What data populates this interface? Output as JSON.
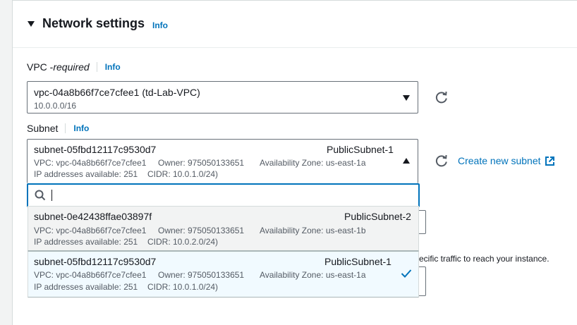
{
  "section": {
    "title": "Network settings",
    "info": "Info"
  },
  "vpc": {
    "label": "VPC - ",
    "required": "required",
    "info": "Info",
    "selected": "vpc-04a8b66f7ce7cfee1 (td-Lab-VPC)",
    "cidr": "10.0.0.0/16"
  },
  "subnet": {
    "label": "Subnet",
    "info": "Info",
    "selected": {
      "id": "subnet-05fbd12117c9530d7",
      "name": "PublicSubnet-1",
      "vpc": "VPC: vpc-04a8b66f7ce7cfee1",
      "owner": "Owner: 975050133651",
      "az": "Availability Zone: us-east-1a",
      "ips": "IP addresses available: 251",
      "cidr": "CIDR: 10.0.1.0/24)"
    },
    "create_link": "Create new subnet",
    "search_placeholder": "",
    "options": [
      {
        "id": "subnet-0e42438ffae03897f",
        "name": "PublicSubnet-2",
        "vpc": "VPC: vpc-04a8b66f7ce7cfee1",
        "owner": "Owner: 975050133651",
        "az": "Availability Zone: us-east-1b",
        "ips": "IP addresses available: 251",
        "cidr": "CIDR: 10.0.2.0/24)"
      },
      {
        "id": "subnet-05fbd12117c9530d7",
        "name": "PublicSubnet-1",
        "vpc": "VPC: vpc-04a8b66f7ce7cfee1",
        "owner": "Owner: 975050133651",
        "az": "Availability Zone: us-east-1a",
        "ips": "IP addresses available: 251",
        "cidr": "CIDR: 10.0.1.0/24)"
      }
    ]
  },
  "background": {
    "partial_text": "ecific traffic to reach your instance."
  },
  "colors": {
    "link": "#0073bb",
    "focus": "#0073bb",
    "selected_bg": "#f1faff"
  }
}
